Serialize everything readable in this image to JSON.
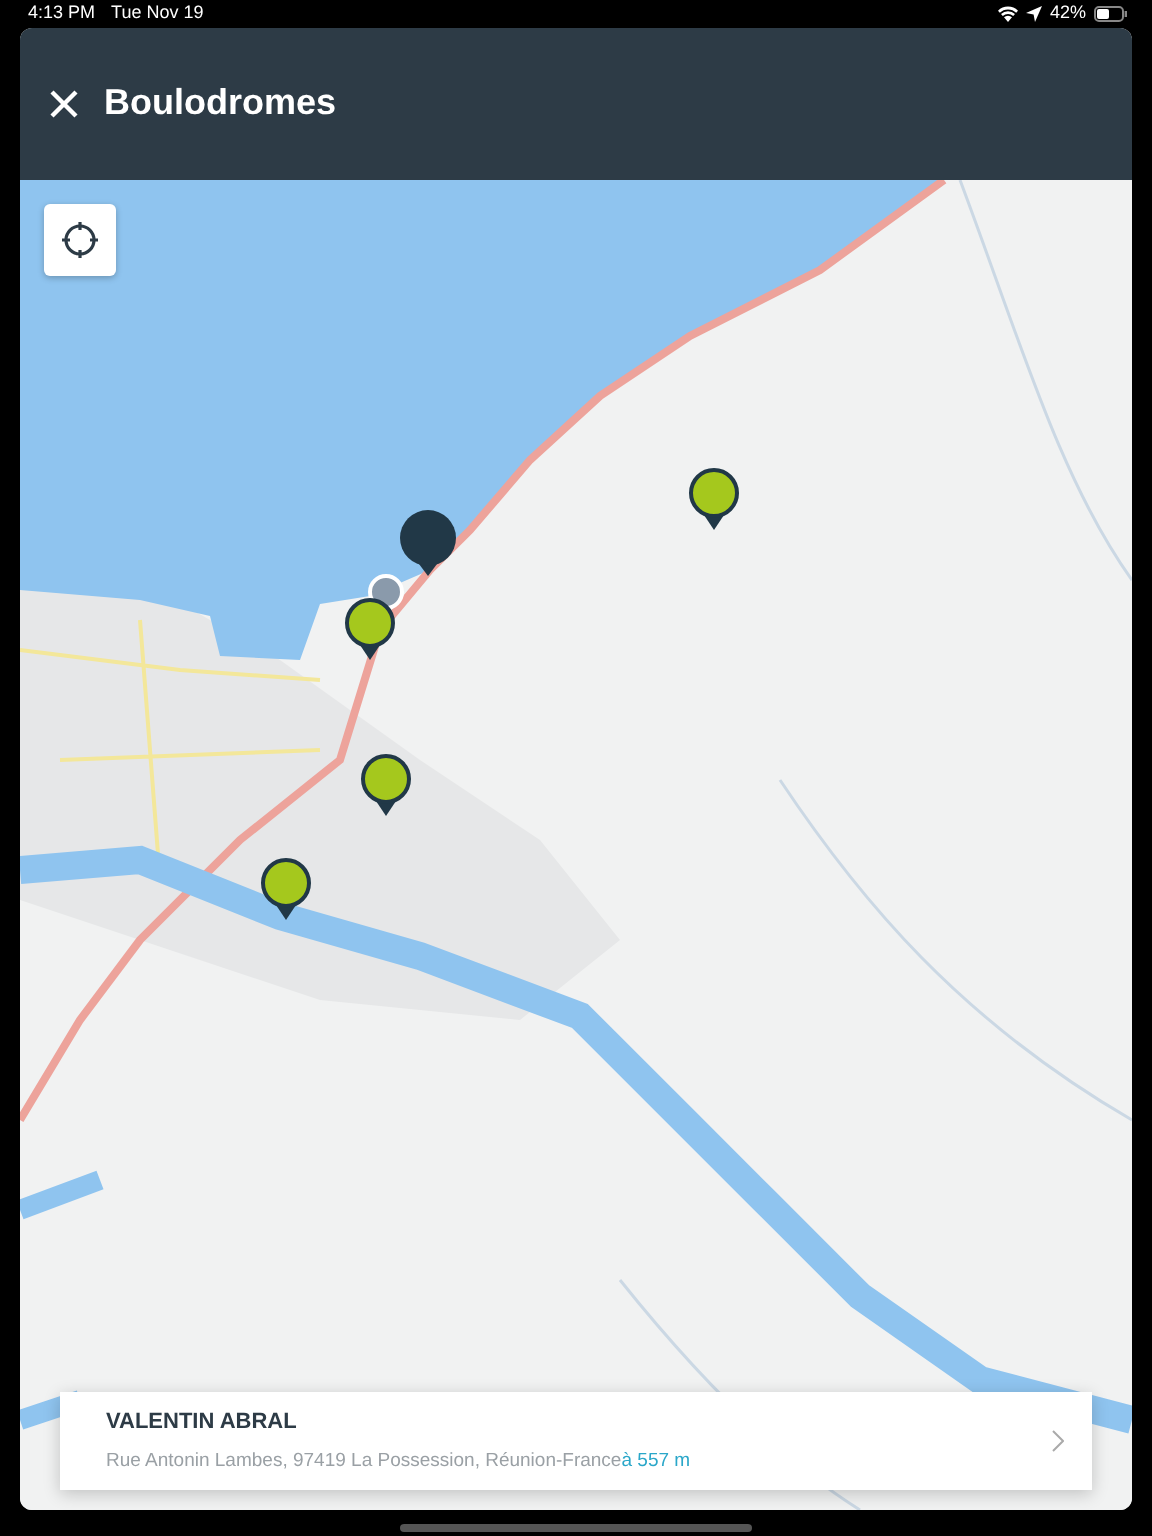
{
  "status_bar": {
    "time": "4:13 PM",
    "date": "Tue Nov 19",
    "battery": "42%"
  },
  "header": {
    "title": "Boulodromes"
  },
  "map": {
    "pins": [
      {
        "selected": true
      },
      {
        "selected": false
      },
      {
        "selected": false
      },
      {
        "selected": false
      },
      {
        "selected": false
      }
    ]
  },
  "result_card": {
    "name": "VALENTIN ABRAL",
    "address": "Rue Antonin Lambes, 97419 La Possession, Réunion-France",
    "distance": "à 557 m"
  }
}
